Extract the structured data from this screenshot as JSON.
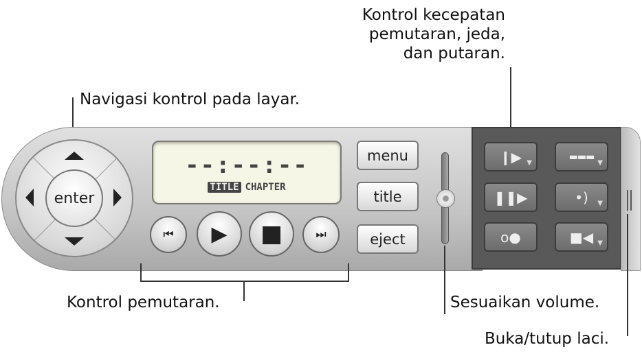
{
  "callouts": {
    "speed": [
      "Kontrol kecepatan",
      "pemutaran, jeda,",
      "dan putaran."
    ],
    "navigation": "Navigasi kontrol pada layar.",
    "playback": "Kontrol pemutaran.",
    "volume": "Sesuaikan volume.",
    "drawer": "Buka/tutup laci."
  },
  "player": {
    "enter": "enter",
    "time": "--:--:--",
    "lcd_title": "TITLE",
    "lcd_chapter": "CHAPTER",
    "menu": "menu",
    "title": "title",
    "eject": "eject",
    "icons": {
      "prev": "⏮",
      "play": "▶",
      "stop": "■",
      "next": "⏭"
    },
    "drawer_buttons": [
      "playback-speed-icon",
      "subtitle-icon",
      "pause-step-icon",
      "audio-icon",
      "loop-icon",
      "camera-angle-icon"
    ]
  },
  "colors": {
    "drawer": "#595959",
    "lcd": "#f6f6e6"
  }
}
